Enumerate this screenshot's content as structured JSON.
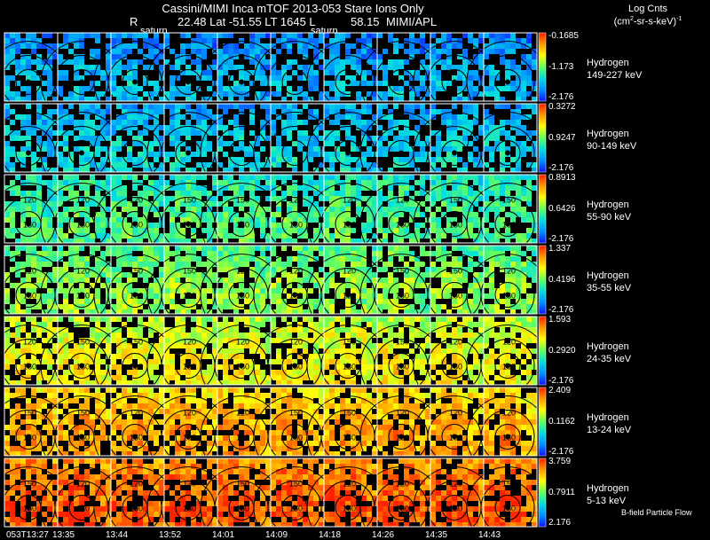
{
  "header": {
    "title": "Cassini/MIMI Inca mTOF  2013-053   Stare   Ions Only",
    "pos_r_label": "R",
    "pos_values": "22.48 Lat -51.55 LT 1645 L",
    "pos_l_value": "58.15",
    "lab": "MIMI/APL",
    "saturn_labels": [
      "saturn",
      "saturn"
    ]
  },
  "colorbar_title": {
    "line1": "Log Cnts",
    "line2_base": "(cm",
    "line2_sup1": "2",
    "line2_mid": "-sr-s-keV)",
    "line2_sup2": "-1"
  },
  "footer": {
    "bfield_label": "B-field Particle Flow"
  },
  "colors": {
    "scale": [
      "#1010ff",
      "#0090ff",
      "#00e0e0",
      "#60ff60",
      "#ffff00",
      "#ff9900",
      "#ff2000"
    ]
  },
  "chart_data": {
    "type": "heatmap",
    "title": "Cassini/MIMI Inca mTOF  2013-053   Stare   Ions Only",
    "x_ticks": [
      "053T13:27",
      "13:35",
      "13:44",
      "13:52",
      "14:01",
      "14:09",
      "14:18",
      "14:26",
      "14:35",
      "14:43"
    ],
    "contour_labels": [
      "30",
      "60",
      "90",
      "120",
      "150",
      "180"
    ],
    "panels": [
      {
        "species": "Hydrogen",
        "energy": "149-227 keV",
        "cbar_max": "-0.1685",
        "cbar_mid": "-1.173",
        "cbar_min": "-2.176",
        "level": 0.12
      },
      {
        "species": "Hydrogen",
        "energy": "90-149 keV",
        "cbar_max": "0.3272",
        "cbar_mid": "0.9247",
        "cbar_min": "-2.176",
        "level": 0.18
      },
      {
        "species": "Hydrogen",
        "energy": "55-90 keV",
        "cbar_max": "0.8913",
        "cbar_mid": "0.6426",
        "cbar_min": "-2.176",
        "level": 0.33
      },
      {
        "species": "Hydrogen",
        "energy": "35-55 keV",
        "cbar_max": "1.337",
        "cbar_mid": "0.4196",
        "cbar_min": "-2.176",
        "level": 0.42
      },
      {
        "species": "Hydrogen",
        "energy": "24-35 keV",
        "cbar_max": "1.593",
        "cbar_mid": "0.2920",
        "cbar_min": "-2.176",
        "level": 0.55
      },
      {
        "species": "Hydrogen",
        "energy": "13-24 keV",
        "cbar_max": "2.409",
        "cbar_mid": "0.1162",
        "cbar_min": "-2.176",
        "level": 0.68
      },
      {
        "species": "Hydrogen",
        "energy": "5-13 keV",
        "cbar_max": "3.759",
        "cbar_mid": "0.7911",
        "cbar_min": "2.176",
        "level": 0.8
      }
    ]
  }
}
